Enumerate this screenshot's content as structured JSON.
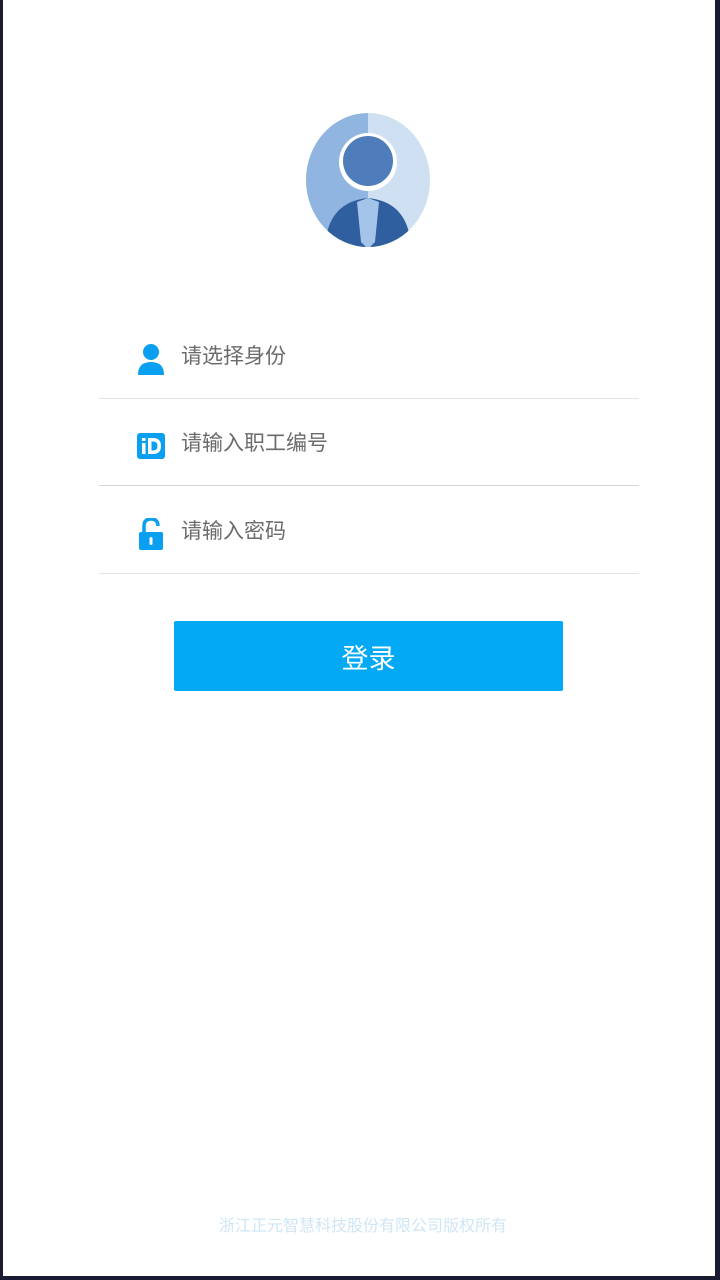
{
  "login": {
    "identity_placeholder": "请选择身份",
    "employee_id_placeholder": "请输入职工编号",
    "password_placeholder": "请输入密码",
    "login_label": "登录"
  },
  "footer": {
    "copyright": "浙江正元智慧科技股份有限公司版权所有"
  },
  "icons": {
    "identity": "user-icon",
    "employee_id": "id-icon",
    "password": "unlock-icon"
  },
  "colors": {
    "accent": "#03a9f4",
    "icon": "#0a9ff0",
    "copyright_text": "#cfe6f5"
  }
}
